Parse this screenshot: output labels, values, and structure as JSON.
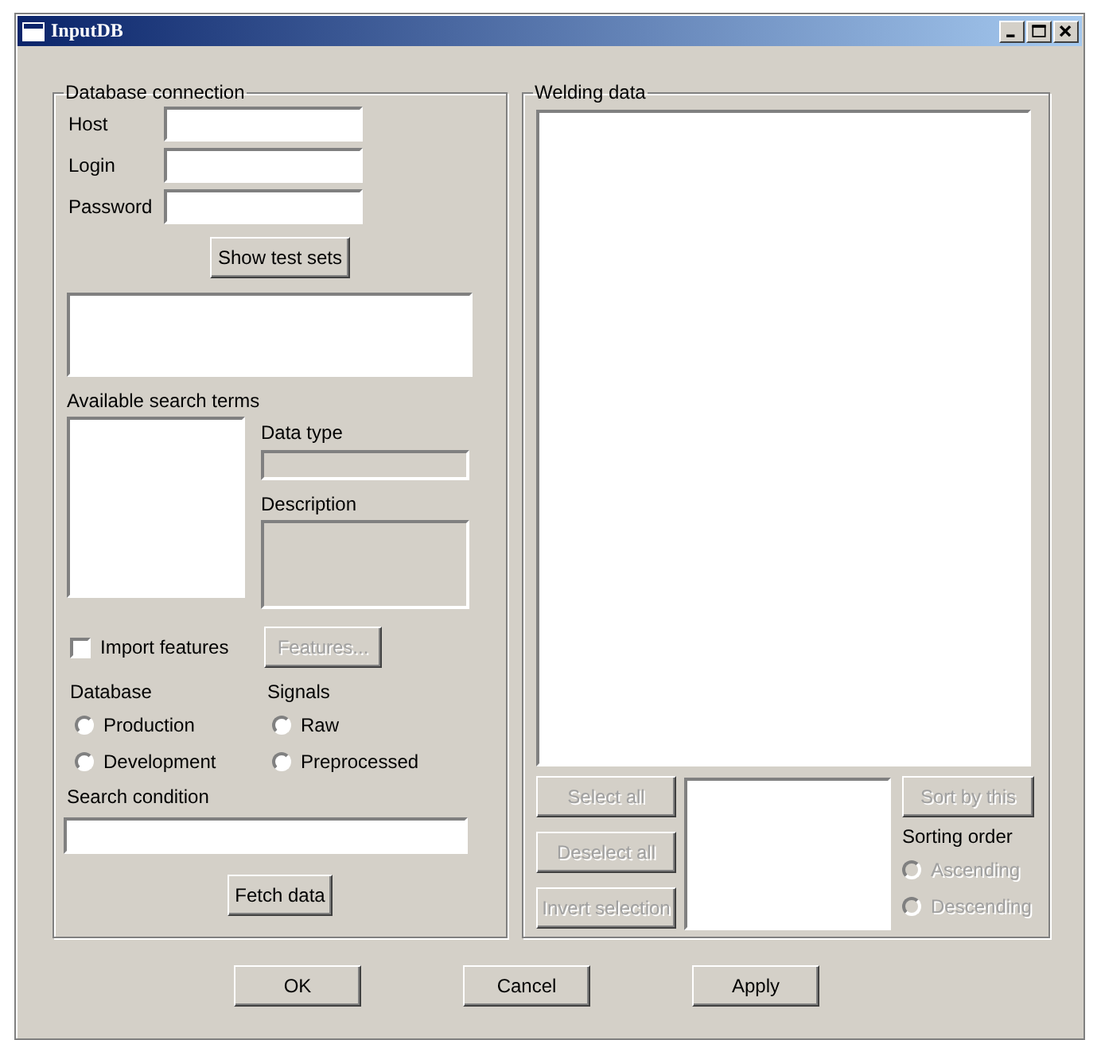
{
  "window": {
    "title": "InputDB"
  },
  "database_connection": {
    "title": "Database connection",
    "fields": [
      {
        "label": "Host"
      },
      {
        "label": "Login"
      },
      {
        "label": "Password"
      }
    ],
    "show_test_sets_button": {
      "label": "Show test sets",
      "disabled": false
    },
    "search_terms_label": "Available search terms",
    "data_type": {
      "label": "Data type",
      "disabled": true
    },
    "description": {
      "label": "Description",
      "disabled": true
    },
    "import_features": {
      "label": "Import features",
      "checked": false
    },
    "features_button": {
      "label": "Features...",
      "disabled": true
    },
    "database": {
      "label": "Database",
      "options": [
        {
          "label": "Production",
          "selected": false
        },
        {
          "label": "Development",
          "selected": false
        }
      ]
    },
    "signals": {
      "label": "Signals",
      "options": [
        {
          "label": "Raw",
          "selected": false
        },
        {
          "label": "Preprocessed",
          "selected": false
        }
      ]
    },
    "search_condition": {
      "label": "Search condition"
    },
    "fetch_button": {
      "label": "Fetch data",
      "disabled": false
    }
  },
  "welding_data": {
    "title": "Welding data",
    "buttons": [
      {
        "label": "Select all",
        "disabled": true
      },
      {
        "label": "Deselect all",
        "disabled": true
      },
      {
        "label": "Invert selection",
        "disabled": true
      }
    ],
    "sort_button": {
      "label": "Sort by this",
      "disabled": true
    },
    "sorting_order": {
      "label": "Sorting order",
      "options": [
        {
          "label": "Ascending",
          "selected": false,
          "disabled": true
        },
        {
          "label": "Descending",
          "selected": false,
          "disabled": true
        }
      ]
    }
  },
  "dialog_buttons": [
    {
      "label": "OK"
    },
    {
      "label": "Cancel"
    },
    {
      "label": "Apply"
    }
  ]
}
